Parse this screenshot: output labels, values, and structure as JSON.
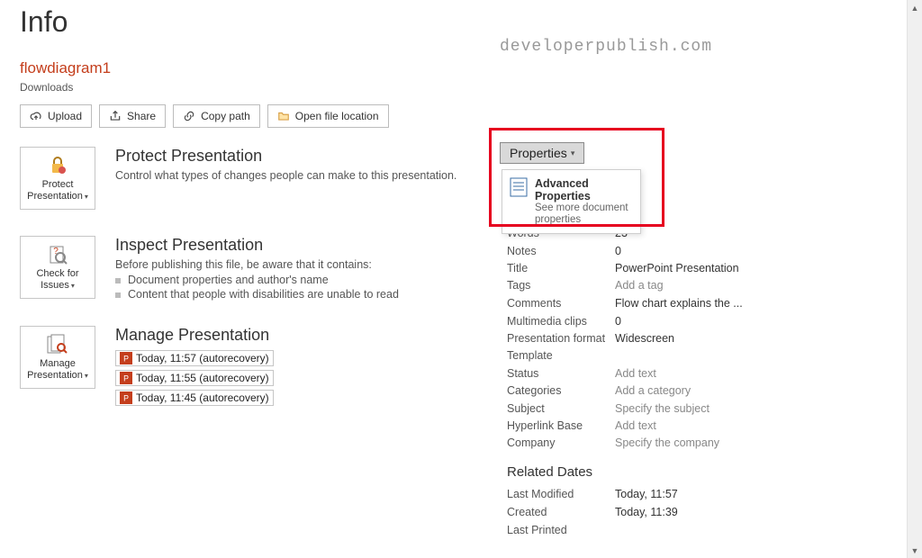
{
  "watermark": "developerpublish.com",
  "page_title": "Info",
  "file": {
    "name": "flowdiagram1",
    "location": "Downloads"
  },
  "actions": {
    "upload": "Upload",
    "share": "Share",
    "copy_path": "Copy path",
    "open_loc": "Open file location"
  },
  "protect": {
    "title": "Protect Presentation",
    "desc": "Control what types of changes people can make to this presentation.",
    "tile_line1": "Protect",
    "tile_line2": "Presentation"
  },
  "inspect": {
    "title": "Inspect Presentation",
    "desc": "Before publishing this file, be aware that it contains:",
    "bullet1": "Document properties and author's name",
    "bullet2": "Content that people with disabilities are unable to read",
    "tile_line1": "Check for",
    "tile_line2": "Issues"
  },
  "manage": {
    "title": "Manage Presentation",
    "tile_line1": "Manage",
    "tile_line2": "Presentation",
    "recov": [
      "Today, 11:57 (autorecovery)",
      "Today, 11:55 (autorecovery)",
      "Today, 11:45 (autorecovery)"
    ]
  },
  "properties": {
    "button": "Properties",
    "adv_title": "Advanced Properties",
    "adv_sub": "See more document properties",
    "rows": {
      "words_k": "Words",
      "words_v": "23",
      "notes_k": "Notes",
      "notes_v": "0",
      "title_k": "Title",
      "title_v": "PowerPoint Presentation",
      "tags_k": "Tags",
      "tags_v": "Add a tag",
      "comments_k": "Comments",
      "comments_v": "Flow chart explains the ...",
      "mm_k": "Multimedia clips",
      "mm_v": "0",
      "fmt_k": "Presentation format",
      "fmt_v": "Widescreen",
      "tpl_k": "Template",
      "tpl_v": "",
      "status_k": "Status",
      "status_v": "Add text",
      "cat_k": "Categories",
      "cat_v": "Add a category",
      "subj_k": "Subject",
      "subj_v": "Specify the subject",
      "hb_k": "Hyperlink Base",
      "hb_v": "Add text",
      "comp_k": "Company",
      "comp_v": "Specify the company"
    },
    "related_title": "Related Dates",
    "dates": {
      "lm_k": "Last Modified",
      "lm_v": "Today, 11:57",
      "cr_k": "Created",
      "cr_v": "Today, 11:39",
      "lp_k": "Last Printed",
      "lp_v": ""
    }
  }
}
